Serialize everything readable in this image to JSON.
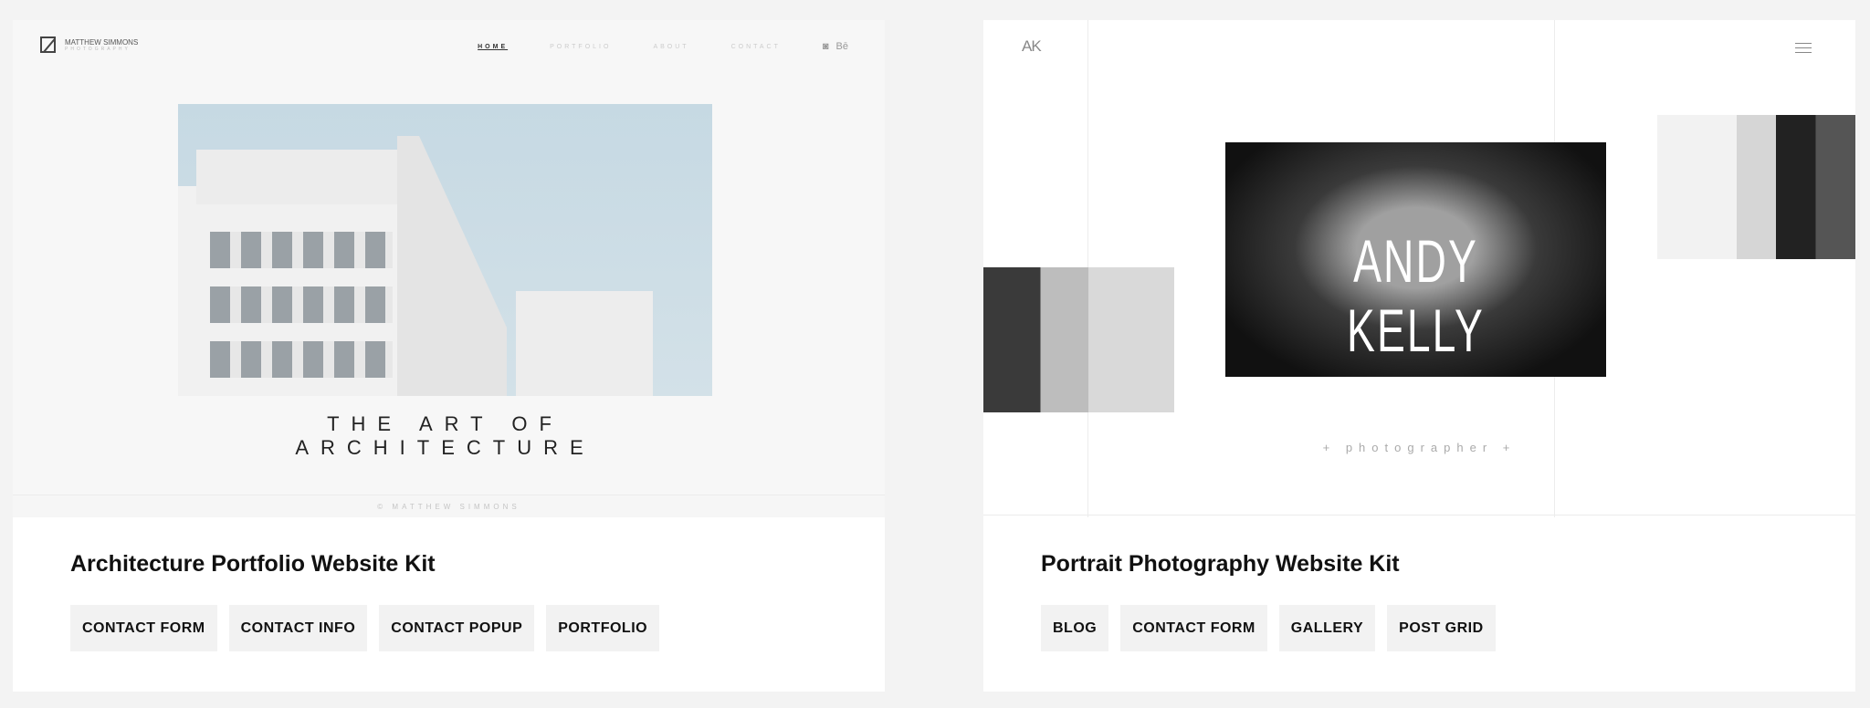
{
  "cards": [
    {
      "title": "Architecture Portfolio Website Kit",
      "tags": [
        "CONTACT FORM",
        "CONTACT INFO",
        "CONTACT POPUP",
        "PORTFOLIO"
      ],
      "preview": {
        "logo_name": "MATTHEW SIMMONS",
        "logo_sub": "PHOTOGRAPHY",
        "nav": [
          "HOME",
          "PORTFOLIO",
          "ABOUT",
          "CONTACT"
        ],
        "social": [
          "instagram-icon",
          "behance-icon"
        ],
        "behance": "Bē",
        "headline": "THE ART OF ARCHITECTURE",
        "footer": "© MATTHEW SIMMONS"
      }
    },
    {
      "title": "Portrait Photography Website Kit",
      "tags": [
        "BLOG",
        "CONTACT FORM",
        "GALLERY",
        "POST GRID"
      ],
      "preview": {
        "logo": "AK",
        "headline": "ANDY KELLY",
        "subtitle": "+ photographer +"
      }
    }
  ]
}
